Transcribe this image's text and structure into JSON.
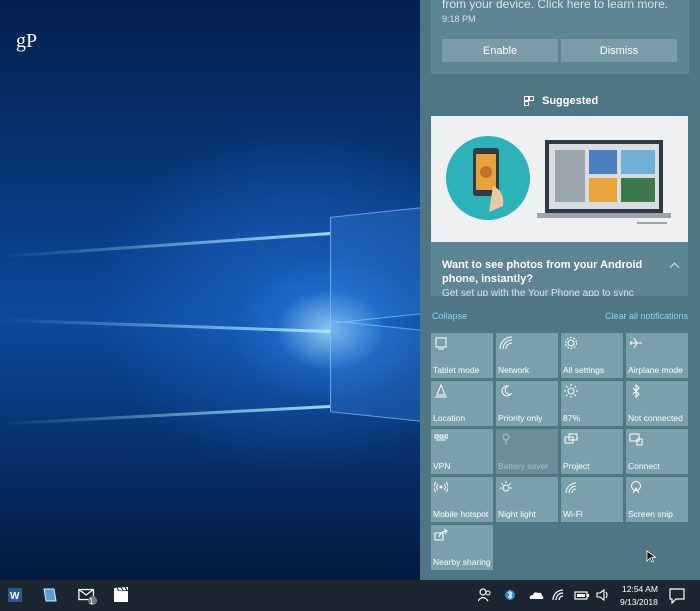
{
  "desktop": {
    "watermark": "gP"
  },
  "notification": {
    "text": "from your device. Click here to learn more.",
    "time": "9:18 PM",
    "enable_label": "Enable",
    "dismiss_label": "Dismiss"
  },
  "suggested": {
    "header": "Suggested",
    "title": "Want to see photos from your Android phone, instantly?",
    "subtitle": "Get set up with the Your Phone app to sync"
  },
  "quick_actions": {
    "collapse_label": "Collapse",
    "clear_label": "Clear all notifications",
    "tiles": [
      {
        "label": "Tablet mode",
        "icon": "tablet-icon",
        "enabled": true
      },
      {
        "label": "Network",
        "icon": "network-icon",
        "enabled": true
      },
      {
        "label": "All settings",
        "icon": "gear-icon",
        "enabled": true
      },
      {
        "label": "Airplane mode",
        "icon": "airplane-icon",
        "enabled": true
      },
      {
        "label": "Location",
        "icon": "location-icon",
        "enabled": true
      },
      {
        "label": "Priority only",
        "icon": "moon-icon",
        "enabled": true
      },
      {
        "label": "87%",
        "icon": "brightness-icon",
        "enabled": true
      },
      {
        "label": "Not connected",
        "icon": "bluetooth-icon",
        "enabled": true
      },
      {
        "label": "VPN",
        "icon": "vpn-icon",
        "enabled": true
      },
      {
        "label": "Battery saver",
        "icon": "battery-saver-icon",
        "enabled": false
      },
      {
        "label": "Project",
        "icon": "project-icon",
        "enabled": true
      },
      {
        "label": "Connect",
        "icon": "connect-icon",
        "enabled": true
      },
      {
        "label": "Mobile hotspot",
        "icon": "hotspot-icon",
        "enabled": true
      },
      {
        "label": "Night light",
        "icon": "night-light-icon",
        "enabled": true
      },
      {
        "label": "Wi-Fi",
        "icon": "wifi-icon",
        "enabled": true
      },
      {
        "label": "Screen snip",
        "icon": "screen-snip-icon",
        "enabled": true
      },
      {
        "label": "Nearby sharing",
        "icon": "nearby-sharing-icon",
        "enabled": true
      }
    ]
  },
  "taskbar": {
    "mail_badge": "1",
    "time": "12:54 AM",
    "date": "9/13/2018",
    "icons": [
      "word-icon",
      "notepad-icon",
      "mail-icon",
      "movies-icon"
    ],
    "tray_icons": [
      "people-icon",
      "bluetooth-icon",
      "onedrive-icon",
      "network-icon",
      "battery-icon",
      "volume-icon",
      "action-center-icon"
    ]
  },
  "colors": {
    "action_center_bg": "#4f7684",
    "tile_bg": "#7aa0ab",
    "link": "#8fd3f0",
    "taskbar_bg": "#1b2631"
  }
}
